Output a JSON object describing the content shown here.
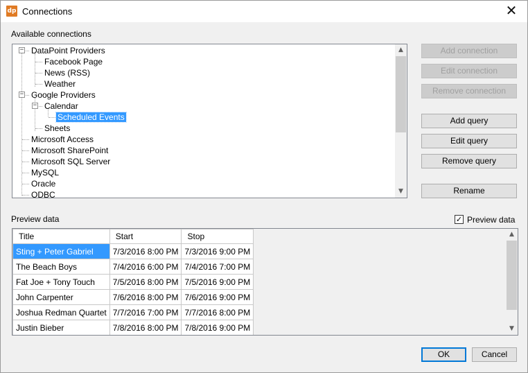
{
  "window": {
    "app_icon_text": "dp",
    "title": "Connections",
    "close_glyph": "✕"
  },
  "connections": {
    "label": "Available connections",
    "tree": [
      {
        "label": "DataPoint Providers",
        "level": 0,
        "expander": "−"
      },
      {
        "label": "Facebook Page",
        "level": 1
      },
      {
        "label": "News (RSS)",
        "level": 1
      },
      {
        "label": "Weather",
        "level": 1
      },
      {
        "label": "Google Providers",
        "level": 0,
        "expander": "−"
      },
      {
        "label": "Calendar",
        "level": 1,
        "expander": "−"
      },
      {
        "label": "Scheduled Events",
        "level": 2,
        "selected": true
      },
      {
        "label": "Sheets",
        "level": 1
      },
      {
        "label": "Microsoft Access",
        "level": 0
      },
      {
        "label": "Microsoft SharePoint",
        "level": 0
      },
      {
        "label": "Microsoft SQL Server",
        "level": 0
      },
      {
        "label": "MySQL",
        "level": 0
      },
      {
        "label": "Oracle",
        "level": 0
      },
      {
        "label": "ODBC",
        "level": 0
      }
    ]
  },
  "buttons": {
    "add_connection": "Add connection",
    "edit_connection": "Edit connection",
    "remove_connection": "Remove connection",
    "add_query": "Add query",
    "edit_query": "Edit query",
    "remove_query": "Remove query",
    "rename": "Rename",
    "ok": "OK",
    "cancel": "Cancel"
  },
  "preview": {
    "label": "Preview data",
    "checkbox_label": "Preview data",
    "checkbox_checked": true,
    "check_glyph": "✓",
    "columns": [
      "Title",
      "Start",
      "Stop"
    ],
    "rows": [
      [
        "Sting + Peter Gabriel",
        "7/3/2016 8:00 PM",
        "7/3/2016 9:00 PM"
      ],
      [
        "The Beach Boys",
        "7/4/2016 6:00 PM",
        "7/4/2016 7:00 PM"
      ],
      [
        "Fat Joe + Tony Touch",
        "7/5/2016 8:00 PM",
        "7/5/2016 9:00 PM"
      ],
      [
        "John Carpenter",
        "7/6/2016 8:00 PM",
        "7/6/2016 9:00 PM"
      ],
      [
        "Joshua Redman Quartet",
        "7/7/2016 7:00 PM",
        "7/7/2016 8:00 PM"
      ],
      [
        "Justin Bieber",
        "7/8/2016 8:00 PM",
        "7/8/2016 9:00 PM"
      ]
    ]
  },
  "scroll": {
    "up_glyph": "▲",
    "down_glyph": "▼"
  }
}
